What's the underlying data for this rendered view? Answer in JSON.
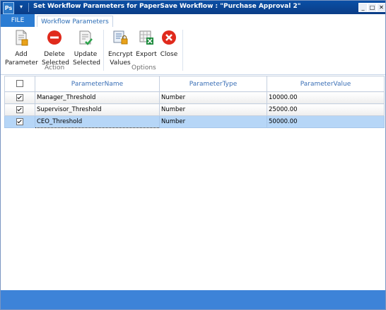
{
  "titlebar": {
    "title": "Set Workflow Parameters for PaperSave Workflow : \"Purchase Approval 2\"",
    "minimize": "_",
    "maximize": "□",
    "close": "✕"
  },
  "tabs": {
    "file": "FILE",
    "workflow_parameters": "Workflow Parameters"
  },
  "ribbon": {
    "action_group": {
      "label": "Action",
      "buttons": [
        {
          "line1": "Add",
          "line2": "Parameter"
        },
        {
          "line1": "Delete",
          "line2": "Selected"
        },
        {
          "line1": "Update",
          "line2": "Selected"
        }
      ]
    },
    "options_group": {
      "label": "Options",
      "buttons": [
        {
          "line1": "Encrypt",
          "line2": "Values"
        },
        {
          "line1": "Export",
          "line2": ""
        },
        {
          "line1": "Close",
          "line2": ""
        }
      ]
    }
  },
  "grid": {
    "columns": [
      "ParameterName",
      "ParameterType",
      "ParameterValue"
    ],
    "rows": [
      {
        "checked": true,
        "name": "Manager_Threshold",
        "type": "Number",
        "value": "10000.00"
      },
      {
        "checked": true,
        "name": "Supervisor_Threshold",
        "type": "Number",
        "value": "25000.00"
      },
      {
        "checked": true,
        "name": "CEO_Threshold",
        "type": "Number",
        "value": "50000.00"
      }
    ]
  },
  "colors": {
    "title_bar": "#0b4a9c",
    "file_tab": "#2b7cd3",
    "selected_row": "#b6d6f7",
    "status_bar": "#3d83d8"
  }
}
